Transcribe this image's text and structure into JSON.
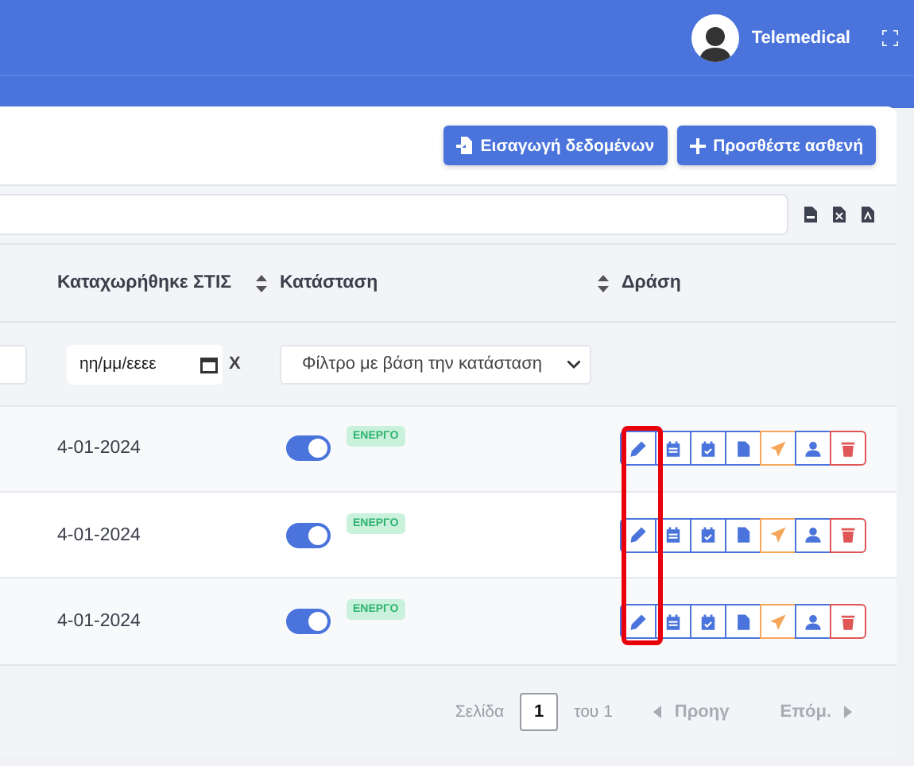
{
  "header": {
    "user_name": "Telemedical"
  },
  "toolbar_buttons": [
    {
      "kind": "import",
      "label": "Εισαγωγή δεδομένων"
    },
    {
      "kind": "add",
      "label": "Προσθέστε ασθενή"
    }
  ],
  "export_icons": [
    {
      "kind": "csv"
    },
    {
      "kind": "excel"
    },
    {
      "kind": "pdf"
    }
  ],
  "table": {
    "columns": [
      {
        "label": "Καταχωρήθηκε ΣΤΙΣ",
        "sortable": true
      },
      {
        "label": "Κατάσταση",
        "sortable": true
      },
      {
        "label": "Δράση",
        "sortable": false
      }
    ],
    "filters": {
      "date_placeholder": "ηη/μμ/εεεε",
      "clear": "X",
      "status_placeholder": "Φίλτρο με βάση την κατάσταση"
    },
    "rows": [
      {
        "date": "4-01-2024",
        "on": true,
        "badge": "ΕΝΕΡΓΟ"
      },
      {
        "date": "4-01-2024",
        "on": true,
        "badge": "ΕΝΕΡΓΟ"
      },
      {
        "date": "4-01-2024",
        "on": true,
        "badge": "ΕΝΕΡΓΟ"
      }
    ]
  },
  "row_actions": [
    {
      "kind": "edit"
    },
    {
      "kind": "calendar"
    },
    {
      "kind": "calendar-check"
    },
    {
      "kind": "document"
    },
    {
      "kind": "send"
    },
    {
      "kind": "user"
    },
    {
      "kind": "delete"
    }
  ],
  "edit_column_highlighted": true,
  "pagination": {
    "page_label": "Σελίδα",
    "page_value": "1",
    "of_label": "του 1",
    "prev": {
      "label": "Προηγ",
      "disabled": true
    },
    "next": {
      "label": "Επόμ.",
      "disabled": true
    }
  }
}
